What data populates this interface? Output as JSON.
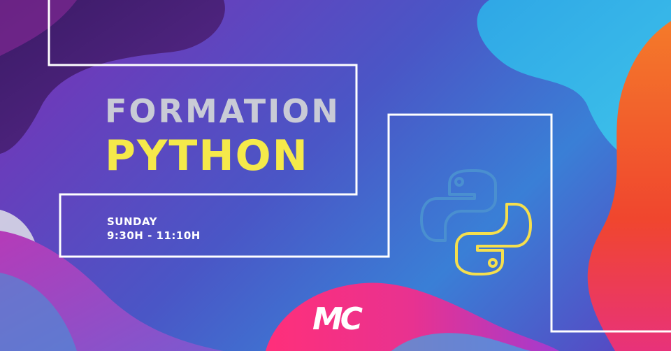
{
  "title_line1": "FORMATION",
  "title_line2": "PYTHON",
  "schedule": {
    "day": "SUNDAY",
    "time": "9:30H - 11:10H"
  },
  "brand": {
    "logo_text": "MC",
    "logo_icon": "mc-logo"
  },
  "icons": {
    "python": "python-logo-icon"
  },
  "colors": {
    "title_line1": "#c9cbd6",
    "title_line2": "#f5e94a",
    "python_blue": "#4a8fd0",
    "python_yellow": "#f5df4d",
    "accent_orange": "#f0642a",
    "accent_pink": "#e8327a"
  }
}
